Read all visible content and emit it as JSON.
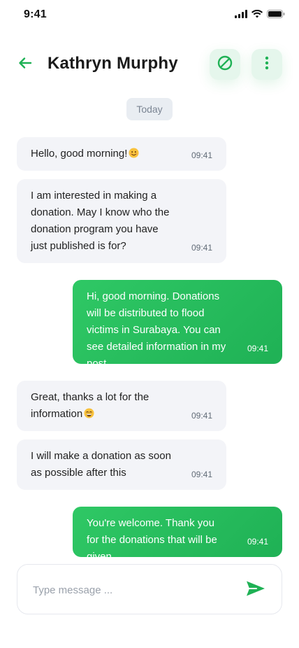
{
  "status_bar": {
    "time": "9:41",
    "icons": [
      "signal-icon",
      "wifi-icon",
      "battery-icon"
    ]
  },
  "header": {
    "contact_name": "Kathryn Murphy",
    "icons": {
      "back": "arrow-left-icon",
      "block": "block-icon",
      "more": "more-vertical-icon"
    }
  },
  "date_separator": "Today",
  "messages": [
    {
      "direction": "incoming",
      "text": "Hello, good morning!",
      "emoji": "smiling-face",
      "time": "09:41"
    },
    {
      "direction": "incoming",
      "text": "I am interested in making a donation. May I know who the donation program you have just published is for?",
      "time": "09:41"
    },
    {
      "direction": "outgoing",
      "text": "Hi, good morning. Donations will be distributed to flood victims in Surabaya. You can see detailed information in my post",
      "time": "09:41"
    },
    {
      "direction": "incoming",
      "text": "Great, thanks a lot for the information",
      "emoji": "grinning-face",
      "time": "09:41"
    },
    {
      "direction": "incoming",
      "text": "I will make a donation as soon as possible after this",
      "time": "09:41"
    },
    {
      "direction": "outgoing",
      "text": "You're welcome. Thank you for the donations that will be given.",
      "time": "09:41"
    }
  ],
  "composer": {
    "placeholder": "Type message ...",
    "send_icon": "send-icon"
  },
  "colors": {
    "accent": "#1fb155",
    "accent_light": "#e5f6ec",
    "incoming_bubble": "#f3f4f8",
    "date_chip": "#e9edf2"
  }
}
